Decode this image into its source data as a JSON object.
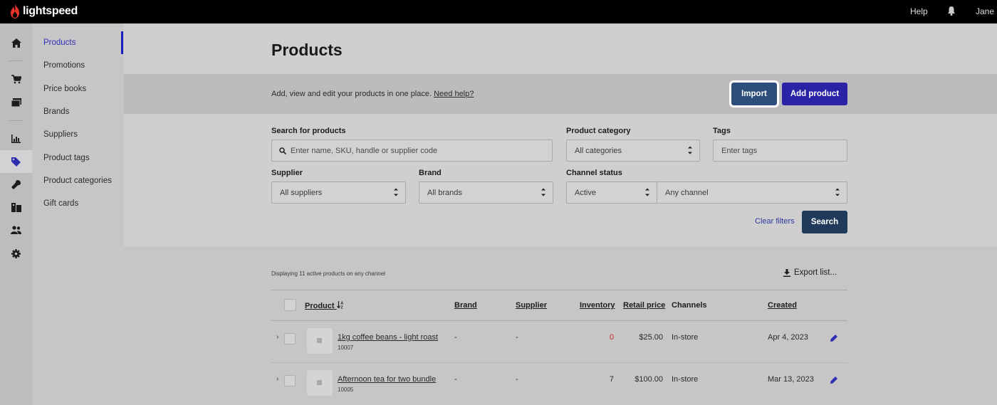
{
  "topbar": {
    "brand": "lightspeed",
    "help": "Help",
    "user": "Jane"
  },
  "submenu": [
    "Products",
    "Promotions",
    "Price books",
    "Brands",
    "Suppliers",
    "Product tags",
    "Product categories",
    "Gift cards"
  ],
  "page": {
    "title": "Products",
    "intro": "Add, view and edit your products in one place.",
    "help_link": "Need help?",
    "import_label": "Import",
    "add_label": "Add product"
  },
  "filters": {
    "search_label": "Search for products",
    "search_placeholder": "Enter name, SKU, handle or supplier code",
    "category_label": "Product category",
    "category_value": "All categories",
    "tags_label": "Tags",
    "tags_placeholder": "Enter tags",
    "supplier_label": "Supplier",
    "supplier_value": "All suppliers",
    "brand_label": "Brand",
    "brand_value": "All brands",
    "channel_label": "Channel status",
    "status_value": "Active",
    "channel_value": "Any channel",
    "clear_label": "Clear filters",
    "search_button": "Search"
  },
  "list": {
    "count_text": "Displaying 11 active products on any channel",
    "export_label": "Export list...",
    "headers": {
      "product": "Product",
      "brand": "Brand",
      "supplier": "Supplier",
      "inventory": "Inventory",
      "price": "Retail price",
      "channels": "Channels",
      "created": "Created"
    },
    "rows": [
      {
        "name": "1kg coffee beans - light roast",
        "sku": "10007",
        "brand": "-",
        "supplier": "-",
        "inventory": "0",
        "price": "$25.00",
        "channels": "In-store",
        "created": "Apr 4, 2023"
      },
      {
        "name": "Afternoon tea for two bundle",
        "sku": "10005",
        "brand": "-",
        "supplier": "-",
        "inventory": "7",
        "price": "$100.00",
        "channels": "In-store",
        "created": "Mar 13, 2023"
      }
    ]
  },
  "colors": {
    "primary": "#2a23a6",
    "import": "#2b4e7a",
    "active_nav": "#1c1fbd",
    "zero_inventory": "#c8332c"
  },
  "icons": [
    "home-icon",
    "cart-icon",
    "register-icon",
    "reports-icon",
    "tag-icon",
    "wrench-icon",
    "inventory-icon",
    "customers-icon",
    "settings-icon",
    "bell-icon",
    "search-icon",
    "download-icon",
    "edit-icon"
  ]
}
